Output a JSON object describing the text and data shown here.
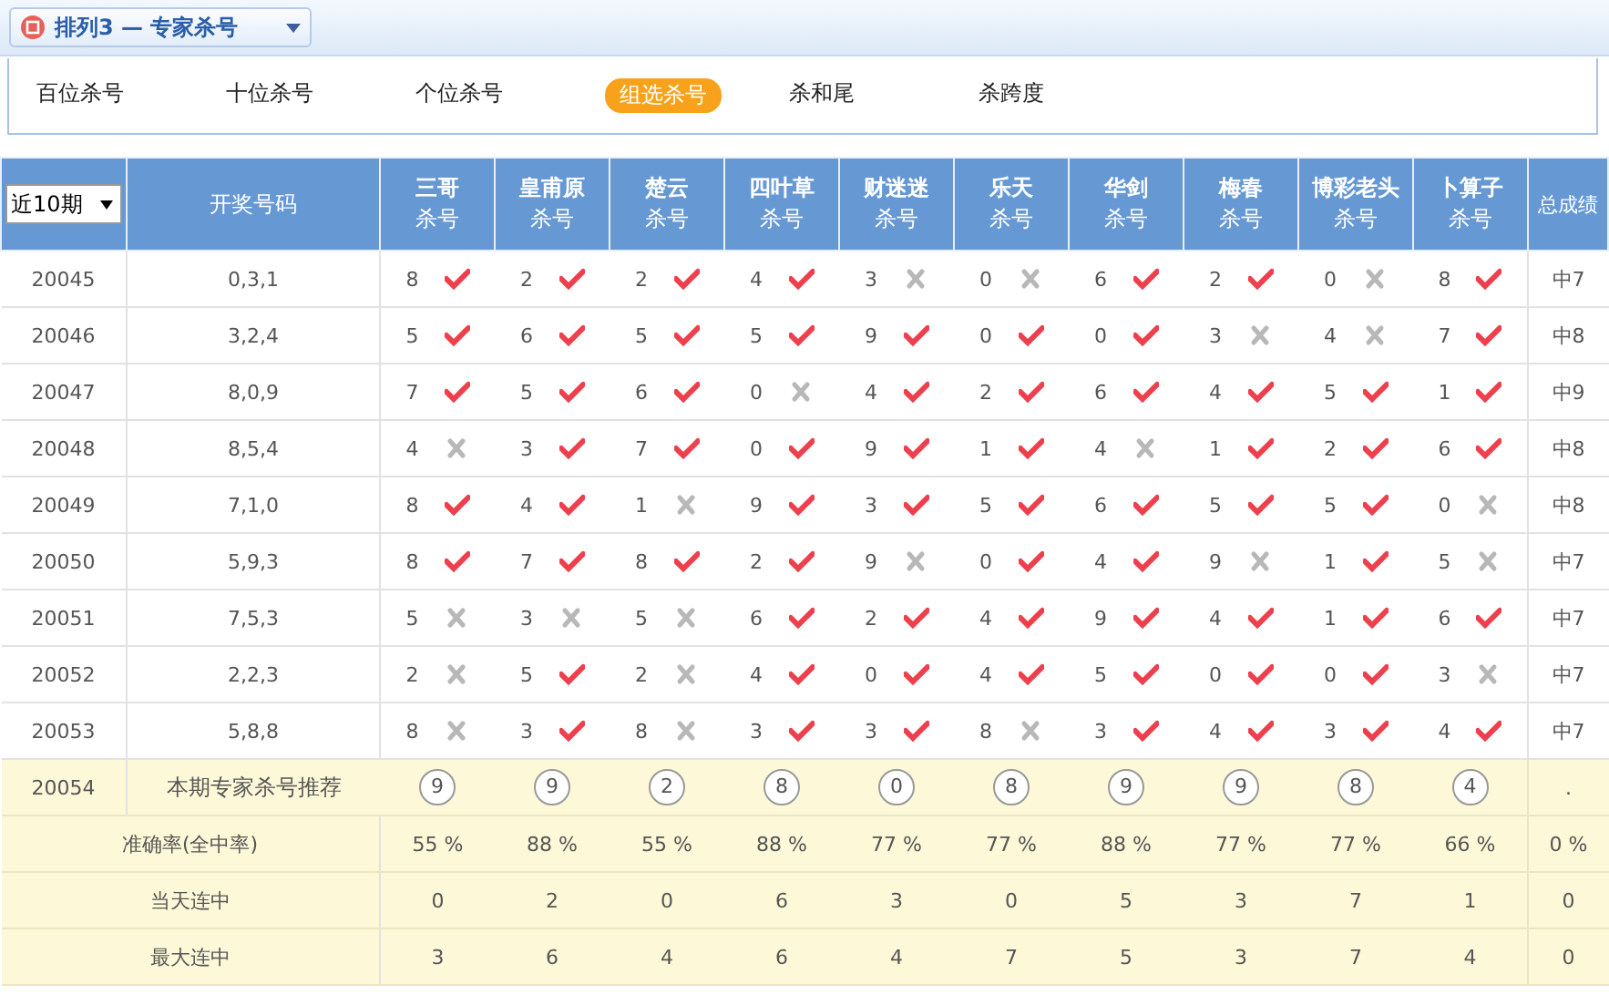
{
  "header_bar": {
    "title": "排列3 — 专家杀号"
  },
  "tabs": [
    {
      "label": "百位杀号",
      "selected": false
    },
    {
      "label": "十位杀号",
      "selected": false
    },
    {
      "label": "个位杀号",
      "selected": false
    },
    {
      "label": "组选杀号",
      "selected": true
    },
    {
      "label": "杀和尾",
      "selected": false
    },
    {
      "label": "杀跨度",
      "selected": false
    }
  ],
  "table": {
    "period_filter": "近10期",
    "draw_heading": "开奖号码",
    "total_heading": "总成绩",
    "columns": [
      {
        "name": "三哥",
        "sub": "杀号"
      },
      {
        "name": "皇甫原",
        "sub": "杀号"
      },
      {
        "name": "楚云",
        "sub": "杀号"
      },
      {
        "name": "四叶草",
        "sub": "杀号"
      },
      {
        "name": "财迷迷",
        "sub": "杀号"
      },
      {
        "name": "乐天",
        "sub": "杀号"
      },
      {
        "name": "华剑",
        "sub": "杀号"
      },
      {
        "name": "梅春",
        "sub": "杀号"
      },
      {
        "name": "博彩老头",
        "sub": "杀号"
      },
      {
        "name": "卜算子",
        "sub": "杀号"
      }
    ],
    "rows": [
      {
        "period": "20045",
        "draw": "0,3,1",
        "picks": [
          {
            "num": "8",
            "hit": true
          },
          {
            "num": "2",
            "hit": true
          },
          {
            "num": "2",
            "hit": true
          },
          {
            "num": "4",
            "hit": true
          },
          {
            "num": "3",
            "hit": false
          },
          {
            "num": "0",
            "hit": false
          },
          {
            "num": "6",
            "hit": true
          },
          {
            "num": "2",
            "hit": true
          },
          {
            "num": "0",
            "hit": false
          },
          {
            "num": "8",
            "hit": true
          }
        ],
        "total": "中7"
      },
      {
        "period": "20046",
        "draw": "3,2,4",
        "picks": [
          {
            "num": "5",
            "hit": true
          },
          {
            "num": "6",
            "hit": true
          },
          {
            "num": "5",
            "hit": true
          },
          {
            "num": "5",
            "hit": true
          },
          {
            "num": "9",
            "hit": true
          },
          {
            "num": "0",
            "hit": true
          },
          {
            "num": "0",
            "hit": true
          },
          {
            "num": "3",
            "hit": false
          },
          {
            "num": "4",
            "hit": false
          },
          {
            "num": "7",
            "hit": true
          }
        ],
        "total": "中8"
      },
      {
        "period": "20047",
        "draw": "8,0,9",
        "picks": [
          {
            "num": "7",
            "hit": true
          },
          {
            "num": "5",
            "hit": true
          },
          {
            "num": "6",
            "hit": true
          },
          {
            "num": "0",
            "hit": false
          },
          {
            "num": "4",
            "hit": true
          },
          {
            "num": "2",
            "hit": true
          },
          {
            "num": "6",
            "hit": true
          },
          {
            "num": "4",
            "hit": true
          },
          {
            "num": "5",
            "hit": true
          },
          {
            "num": "1",
            "hit": true
          }
        ],
        "total": "中9"
      },
      {
        "period": "20048",
        "draw": "8,5,4",
        "picks": [
          {
            "num": "4",
            "hit": false
          },
          {
            "num": "3",
            "hit": true
          },
          {
            "num": "7",
            "hit": true
          },
          {
            "num": "0",
            "hit": true
          },
          {
            "num": "9",
            "hit": true
          },
          {
            "num": "1",
            "hit": true
          },
          {
            "num": "4",
            "hit": false
          },
          {
            "num": "1",
            "hit": true
          },
          {
            "num": "2",
            "hit": true
          },
          {
            "num": "6",
            "hit": true
          }
        ],
        "total": "中8"
      },
      {
        "period": "20049",
        "draw": "7,1,0",
        "picks": [
          {
            "num": "8",
            "hit": true
          },
          {
            "num": "4",
            "hit": true
          },
          {
            "num": "1",
            "hit": false
          },
          {
            "num": "9",
            "hit": true
          },
          {
            "num": "3",
            "hit": true
          },
          {
            "num": "5",
            "hit": true
          },
          {
            "num": "6",
            "hit": true
          },
          {
            "num": "5",
            "hit": true
          },
          {
            "num": "5",
            "hit": true
          },
          {
            "num": "0",
            "hit": false
          }
        ],
        "total": "中8"
      },
      {
        "period": "20050",
        "draw": "5,9,3",
        "picks": [
          {
            "num": "8",
            "hit": true
          },
          {
            "num": "7",
            "hit": true
          },
          {
            "num": "8",
            "hit": true
          },
          {
            "num": "2",
            "hit": true
          },
          {
            "num": "9",
            "hit": false
          },
          {
            "num": "0",
            "hit": true
          },
          {
            "num": "4",
            "hit": true
          },
          {
            "num": "9",
            "hit": false
          },
          {
            "num": "1",
            "hit": true
          },
          {
            "num": "5",
            "hit": false
          }
        ],
        "total": "中7"
      },
      {
        "period": "20051",
        "draw": "7,5,3",
        "picks": [
          {
            "num": "5",
            "hit": false
          },
          {
            "num": "3",
            "hit": false
          },
          {
            "num": "5",
            "hit": false
          },
          {
            "num": "6",
            "hit": true
          },
          {
            "num": "2",
            "hit": true
          },
          {
            "num": "4",
            "hit": true
          },
          {
            "num": "9",
            "hit": true
          },
          {
            "num": "4",
            "hit": true
          },
          {
            "num": "1",
            "hit": true
          },
          {
            "num": "6",
            "hit": true
          }
        ],
        "total": "中7"
      },
      {
        "period": "20052",
        "draw": "2,2,3",
        "picks": [
          {
            "num": "2",
            "hit": false
          },
          {
            "num": "5",
            "hit": true
          },
          {
            "num": "2",
            "hit": false
          },
          {
            "num": "4",
            "hit": true
          },
          {
            "num": "0",
            "hit": true
          },
          {
            "num": "4",
            "hit": true
          },
          {
            "num": "5",
            "hit": true
          },
          {
            "num": "0",
            "hit": true
          },
          {
            "num": "0",
            "hit": true
          },
          {
            "num": "3",
            "hit": false
          }
        ],
        "total": "中7"
      },
      {
        "period": "20053",
        "draw": "5,8,8",
        "picks": [
          {
            "num": "8",
            "hit": false
          },
          {
            "num": "3",
            "hit": true
          },
          {
            "num": "8",
            "hit": false
          },
          {
            "num": "3",
            "hit": true
          },
          {
            "num": "3",
            "hit": true
          },
          {
            "num": "8",
            "hit": false
          },
          {
            "num": "3",
            "hit": true
          },
          {
            "num": "4",
            "hit": true
          },
          {
            "num": "3",
            "hit": true
          },
          {
            "num": "4",
            "hit": true
          }
        ],
        "total": "中7"
      }
    ],
    "recommend": {
      "period": "20054",
      "label": "本期专家杀号推荐",
      "picks": [
        "9",
        "9",
        "2",
        "8",
        "0",
        "8",
        "9",
        "9",
        "8",
        "4"
      ],
      "total": "."
    },
    "stats": [
      {
        "label": "准确率(全中率)",
        "values": [
          "55 %",
          "88 %",
          "55 %",
          "88 %",
          "77 %",
          "77 %",
          "88 %",
          "77 %",
          "77 %",
          "66 %"
        ],
        "total": "0 %"
      },
      {
        "label": "当天连中",
        "values": [
          "0",
          "2",
          "0",
          "6",
          "3",
          "0",
          "5",
          "3",
          "7",
          "1"
        ],
        "total": "0"
      },
      {
        "label": "最大连中",
        "values": [
          "3",
          "6",
          "4",
          "6",
          "4",
          "7",
          "5",
          "3",
          "7",
          "4"
        ],
        "total": "0"
      }
    ]
  }
}
